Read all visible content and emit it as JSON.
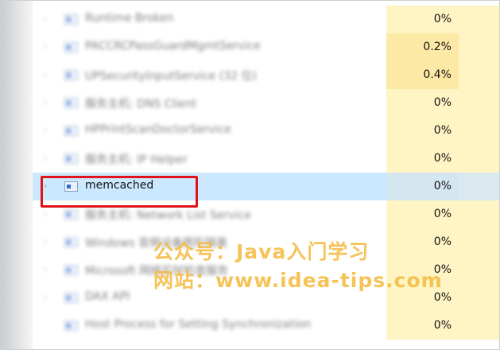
{
  "process_list": {
    "rows": [
      {
        "name": "Runtime Broken",
        "cpu": "0%",
        "expandable": true,
        "highlight": false
      },
      {
        "name": "PACCRCPassGuardMgmtService",
        "cpu": "0.2%",
        "expandable": true,
        "highlight": true
      },
      {
        "name": "UPSecurityInputService (32 位)",
        "cpu": "0.4%",
        "expandable": true,
        "highlight": true
      },
      {
        "name": "服务主机: DNS Client",
        "cpu": "0%",
        "expandable": true,
        "highlight": false
      },
      {
        "name": "HPPrintScanDoctorService",
        "cpu": "0%",
        "expandable": true,
        "highlight": false
      },
      {
        "name": "服务主机: IP Helper",
        "cpu": "0%",
        "expandable": true,
        "highlight": false
      },
      {
        "name": "memcached",
        "cpu": "0%",
        "expandable": true,
        "highlight": false,
        "selected": true
      },
      {
        "name": "服务主机: Network List Service",
        "cpu": "0%",
        "expandable": true,
        "highlight": false
      },
      {
        "name": "Windows 音频设备图形隔离",
        "cpu": "0%",
        "expandable": true,
        "highlight": false
      },
      {
        "name": "Microsoft 网络实时检查服务",
        "cpu": "0%",
        "expandable": true,
        "highlight": false
      },
      {
        "name": "DAX API",
        "cpu": "0%",
        "expandable": true,
        "highlight": false
      },
      {
        "name": "Host Process for Setting Synchronization",
        "cpu": "0%",
        "expandable": false,
        "highlight": false
      }
    ]
  },
  "watermark": {
    "line1": "公众号：Java入门学习",
    "line2": "网站：www.idea-tips.com"
  },
  "colors": {
    "selection": "#cce8ff",
    "cpu_cell": "#fff4c4",
    "highlight_box": "#e0131a",
    "watermark": "#f4b83c"
  }
}
